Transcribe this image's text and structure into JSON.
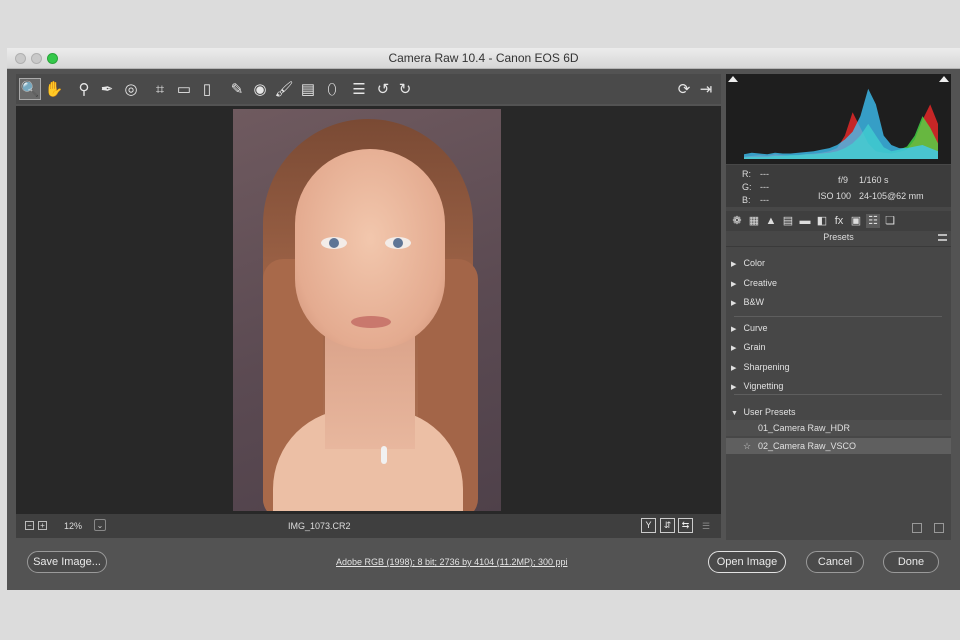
{
  "window": {
    "title": "Camera Raw 10.4  -  Canon EOS 6D"
  },
  "toolbar": {
    "tools": [
      {
        "icon": "zoom-tool-icon",
        "glyph": "🔍"
      },
      {
        "icon": "hand-tool-icon",
        "glyph": "✋"
      },
      {
        "icon": "white-balance-tool-icon",
        "glyph": "⚲"
      },
      {
        "icon": "color-sampler-tool-icon",
        "glyph": "✒"
      },
      {
        "icon": "targeted-adjustment-tool-icon",
        "glyph": "◎"
      },
      {
        "icon": "crop-tool-icon",
        "glyph": "⌗"
      },
      {
        "icon": "straighten-tool-icon",
        "glyph": "▭"
      },
      {
        "icon": "transform-tool-icon",
        "glyph": "▯"
      },
      {
        "icon": "spot-removal-tool-icon",
        "glyph": "✎"
      },
      {
        "icon": "red-eye-removal-tool-icon",
        "glyph": "◉"
      },
      {
        "icon": "adjustment-brush-icon",
        "glyph": "🖌"
      },
      {
        "icon": "graduated-filter-icon",
        "glyph": "▤"
      },
      {
        "icon": "radial-filter-icon",
        "glyph": "⬯"
      },
      {
        "icon": "preferences-list-icon",
        "glyph": "☰"
      },
      {
        "icon": "rotate-ccw-icon",
        "glyph": "↺"
      },
      {
        "icon": "rotate-cw-icon",
        "glyph": "↻"
      }
    ],
    "right_tools": [
      {
        "icon": "preview-cycle-icon",
        "glyph": "⟳"
      },
      {
        "icon": "fullscreen-toggle-icon",
        "glyph": "⇥"
      }
    ]
  },
  "status": {
    "zoom": "12%",
    "zoom_dropdown": "⌄",
    "zoom_out": "−",
    "zoom_in": "+",
    "filename": "IMG_1073.CR2",
    "view_buttons": [
      "Y",
      "⇵",
      "⇆"
    ]
  },
  "readout": {
    "r_label": "R:",
    "r_value": "---",
    "g_label": "G:",
    "g_value": "---",
    "b_label": "B:",
    "b_value": "---",
    "aperture": "f/9",
    "shutter": "1/160 s",
    "iso": "ISO 100",
    "lens": "24-105@62 mm"
  },
  "panel_tabs": [
    "❁",
    "▦",
    "▲",
    "▤",
    "▬",
    "◧",
    "fx",
    "▣",
    "☷",
    "❏"
  ],
  "presets": {
    "title": "Presets",
    "groups": [
      {
        "label": "Color",
        "expanded": false
      },
      {
        "label": "Creative",
        "expanded": false
      },
      {
        "label": "B&W",
        "expanded": false
      },
      {
        "label": "Curve",
        "expanded": false
      },
      {
        "label": "Grain",
        "expanded": false
      },
      {
        "label": "Sharpening",
        "expanded": false
      },
      {
        "label": "Vignetting",
        "expanded": false
      },
      {
        "label": "User Presets",
        "expanded": true
      }
    ],
    "user_presets": [
      "01_Camera Raw_HDR",
      "02_Camera Raw_VSCO"
    ],
    "collapsed_glyph": "▶",
    "expanded_glyph": "▼",
    "star_glyph": "☆"
  },
  "footer": {
    "save_label": "Save Image...",
    "workflow": "Adobe RGB (1998); 8 bit; 2736 by 4104 (11.2MP); 300 ppi",
    "open_label": "Open Image",
    "cancel_label": "Cancel",
    "done_label": "Done"
  },
  "histogram_data": {
    "type": "area",
    "series": [
      {
        "color": "#ff2a2a",
        "values": [
          3,
          4,
          5,
          4,
          6,
          5,
          4,
          5,
          6,
          7,
          8,
          10,
          14,
          30,
          60,
          40,
          20,
          10,
          8,
          7,
          9,
          12,
          25,
          50,
          70,
          45
        ]
      },
      {
        "color": "#47e84a",
        "values": [
          2,
          3,
          3,
          3,
          4,
          4,
          5,
          5,
          6,
          6,
          7,
          8,
          10,
          14,
          20,
          30,
          45,
          30,
          15,
          10,
          12,
          16,
          30,
          55,
          40,
          20
        ]
      },
      {
        "color": "#3fc9ff",
        "values": [
          6,
          8,
          7,
          6,
          8,
          7,
          7,
          8,
          9,
          10,
          12,
          14,
          18,
          25,
          35,
          55,
          90,
          70,
          30,
          18,
          14,
          14,
          16,
          18,
          14,
          10
        ]
      }
    ]
  }
}
